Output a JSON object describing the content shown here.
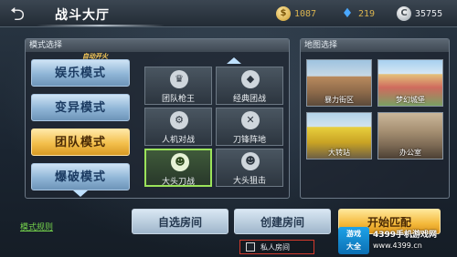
{
  "header": {
    "title": "战斗大厅",
    "currencies": [
      {
        "name": "gold",
        "value": "1087",
        "color": "#d9b34f"
      },
      {
        "name": "diamond",
        "value": "219",
        "color": "#d9b34f"
      },
      {
        "name": "silver",
        "value": "35755",
        "color": "#e6e9ec"
      }
    ]
  },
  "mode_panel": {
    "header": "模式选择",
    "auto_switch": "自动开火",
    "modes": [
      {
        "label": "娱乐模式",
        "selected": false
      },
      {
        "label": "变异模式",
        "selected": false
      },
      {
        "label": "团队模式",
        "selected": true
      },
      {
        "label": "爆破模式",
        "selected": false
      }
    ],
    "sub_modes": [
      {
        "label": "团队枪王",
        "icon": "crown-icon",
        "glyph": "♛",
        "selected": false
      },
      {
        "label": "经典团战",
        "icon": "shield-icon",
        "glyph": "◆",
        "selected": false
      },
      {
        "label": "人机对战",
        "icon": "robot-icon",
        "glyph": "⚙",
        "selected": false
      },
      {
        "label": "刀锋阵地",
        "icon": "blade-icon",
        "glyph": "✕",
        "selected": false
      },
      {
        "label": "大头刀战",
        "icon": "bighead-knife-icon",
        "glyph": "☻",
        "selected": true
      },
      {
        "label": "大头狙击",
        "icon": "bighead-sniper-icon",
        "glyph": "☻",
        "selected": false
      }
    ]
  },
  "map_panel": {
    "header": "地图选择",
    "maps": [
      {
        "label": "暴力街区"
      },
      {
        "label": "梦幻城堡"
      },
      {
        "label": "大转站"
      },
      {
        "label": "办公室"
      }
    ]
  },
  "bottom": {
    "rules_link": "模式规则",
    "choose_room": "自选房间",
    "create_room": "创建房间",
    "start_match": "开始匹配",
    "private_room": "私人房间"
  },
  "watermark": {
    "logo_line1": "游戏",
    "logo_line2": "大全",
    "name": "4399手机游戏网",
    "url": "www.4399.cn"
  }
}
